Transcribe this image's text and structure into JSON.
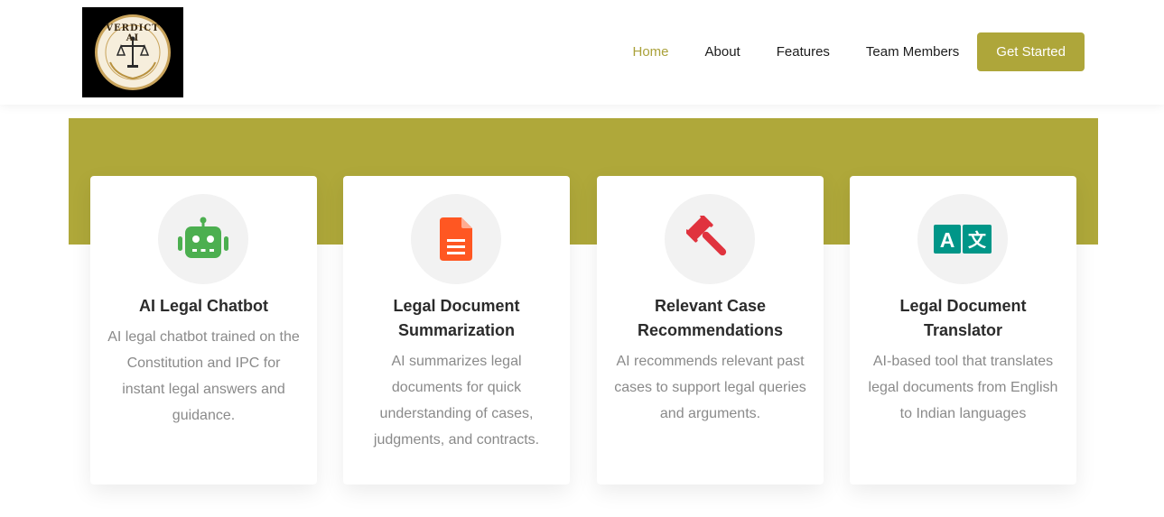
{
  "brand": {
    "logo_text": "VERDICT AI"
  },
  "nav": {
    "items": [
      {
        "label": "Home",
        "active": true
      },
      {
        "label": "About",
        "active": false
      },
      {
        "label": "Features",
        "active": false
      },
      {
        "label": "Team Members",
        "active": false
      }
    ],
    "cta_label": "Get Started"
  },
  "colors": {
    "accent": "#aea63a",
    "band": "#afa83a",
    "robot": "#4caf50",
    "document": "#ff5722",
    "gavel": "#e0333e",
    "translate": "#009688"
  },
  "features": [
    {
      "icon": "robot-icon",
      "title": "AI Legal Chatbot",
      "description": "AI legal chatbot trained on the Constitution and IPC for instant legal answers and guidance."
    },
    {
      "icon": "document-icon",
      "title": "Legal Document Summarization",
      "description": "AI summarizes legal documents for quick understanding of cases, judgments, and contracts."
    },
    {
      "icon": "gavel-icon",
      "title": "Relevant Case Recommendations",
      "description": "AI recommends relevant past cases to support legal queries and arguments."
    },
    {
      "icon": "translate-icon",
      "title": "Legal Document Translator",
      "description": "AI-based tool that translates legal documents from English to Indian languages"
    }
  ]
}
